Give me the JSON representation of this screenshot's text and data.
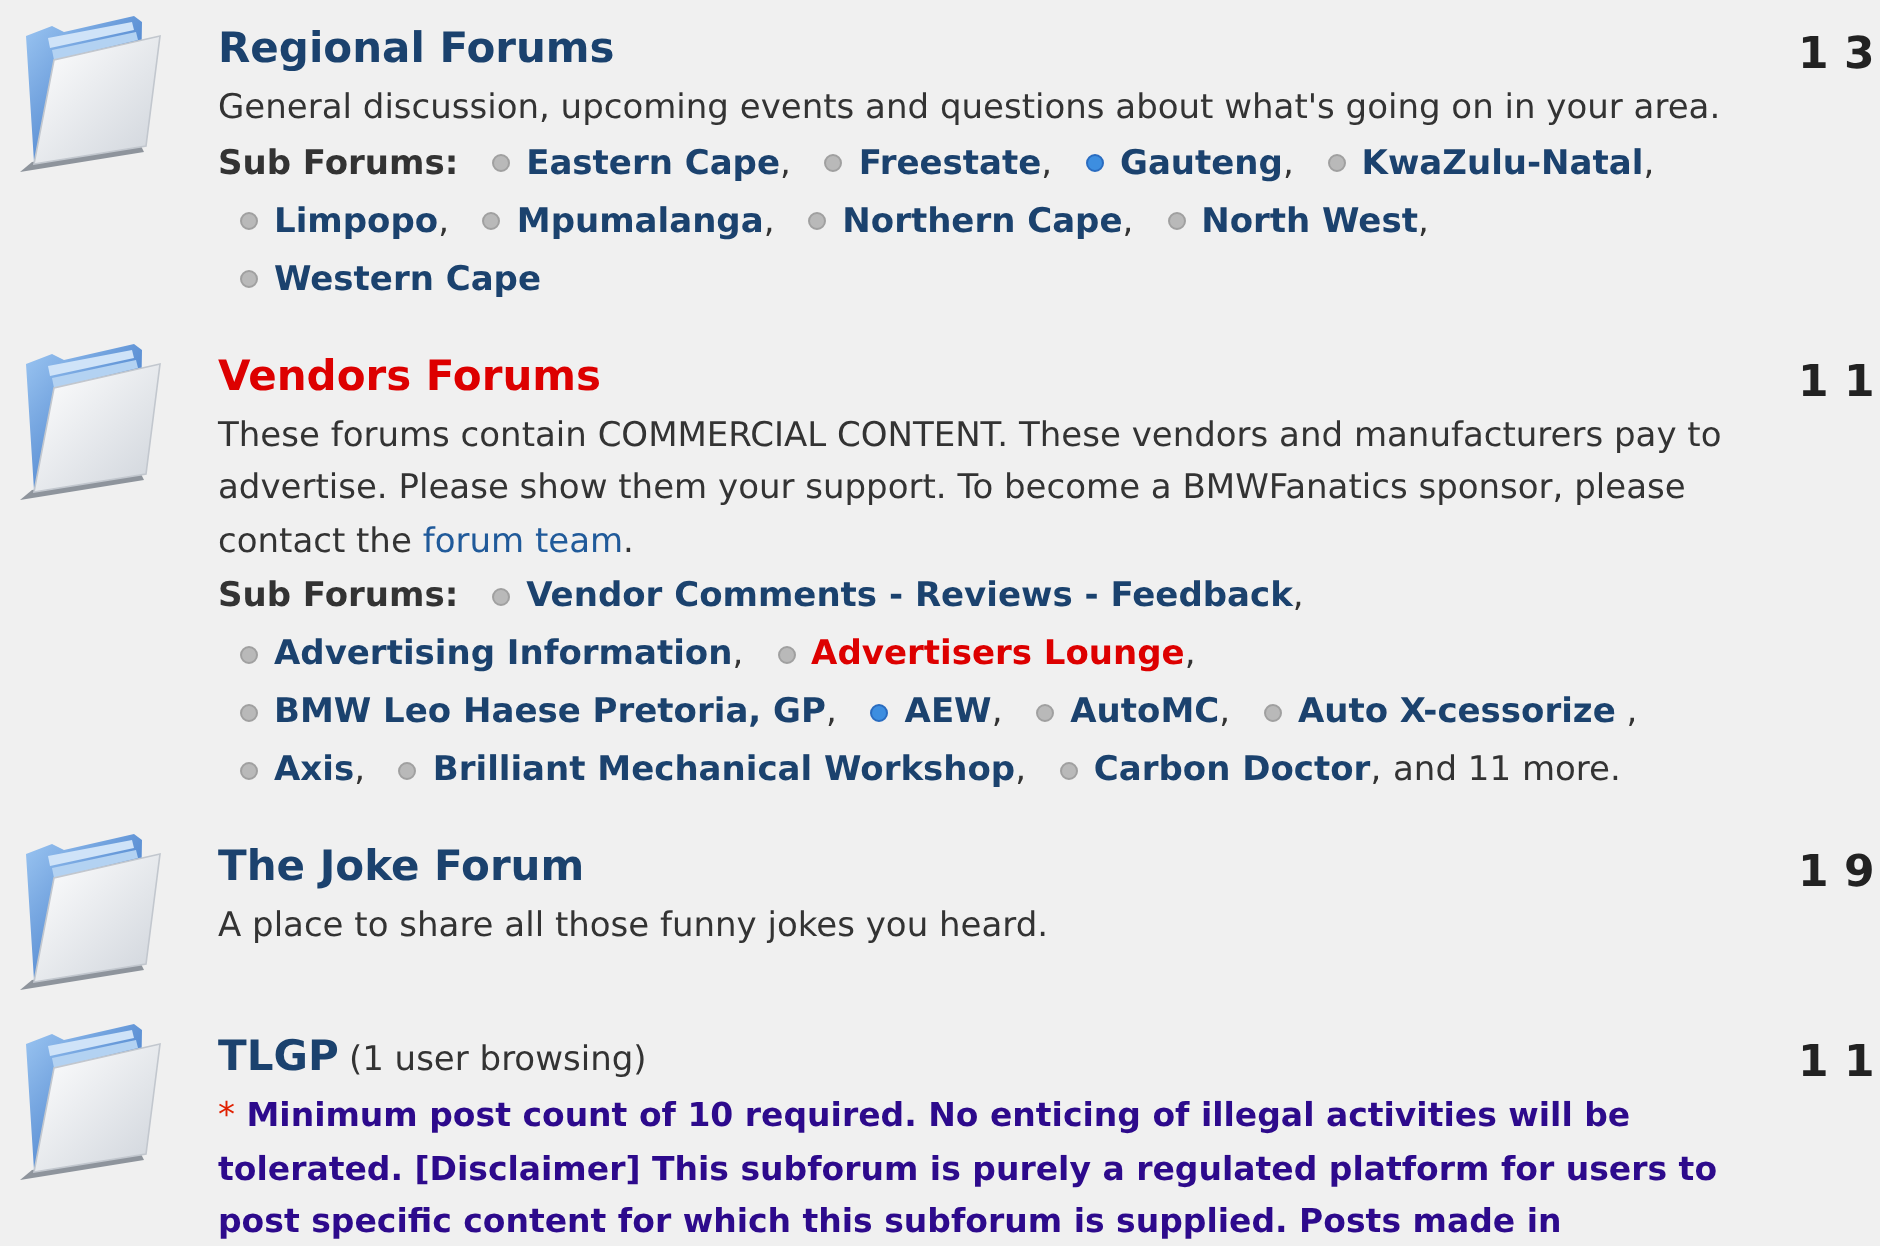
{
  "forums": [
    {
      "title": "Regional Forums",
      "color": "#1b426e",
      "description": [
        {
          "text": "General discussion, upcoming events and questions about what's going on in your area.",
          "kind": "text"
        }
      ],
      "subforums_label": "Sub Forums:",
      "subforums": [
        {
          "name": "Eastern Cape",
          "color": "#1b426e",
          "new_posts": false,
          "separator": ","
        },
        {
          "name": "Freestate",
          "color": "#1b426e",
          "new_posts": false,
          "separator": ","
        },
        {
          "name": "Gauteng",
          "color": "#1b426e",
          "new_posts": true,
          "separator": ","
        },
        {
          "name": "KwaZulu-Natal",
          "color": "#1b426e",
          "new_posts": false,
          "separator": ","
        },
        {
          "name": "Limpopo",
          "color": "#1b426e",
          "new_posts": false,
          "separator": ","
        },
        {
          "name": "Mpumalanga",
          "color": "#1b426e",
          "new_posts": false,
          "separator": ","
        },
        {
          "name": "Northern Cape",
          "color": "#1b426e",
          "new_posts": false,
          "separator": ","
        },
        {
          "name": "North West",
          "color": "#1b426e",
          "new_posts": false,
          "separator": ","
        },
        {
          "name": "Western Cape",
          "color": "#1b426e",
          "new_posts": false
        }
      ],
      "stats": "1 3"
    },
    {
      "title": "Vendors Forums",
      "color": "#dd0000",
      "description": [
        {
          "text": "These forums contain COMMERCIAL CONTENT. These vendors and manufacturers pay to advertise. Please show them your support. To become a BMWFanatics sponsor, please contact the ",
          "kind": "text"
        },
        {
          "text": "forum team",
          "kind": "link"
        },
        {
          "text": ".",
          "kind": "text"
        }
      ],
      "subforums_label": "Sub Forums:",
      "subforums": [
        {
          "name": "Vendor Comments - Reviews - Feedback",
          "color": "#1b426e",
          "new_posts": false,
          "separator": ","
        },
        {
          "name": "Advertising Information",
          "color": "#1b426e",
          "new_posts": false,
          "separator": ","
        },
        {
          "name": "Advertisers Lounge",
          "color": "#dd0000",
          "new_posts": false,
          "separator": ","
        },
        {
          "name": "BMW Leo Haese Pretoria, GP",
          "color": "#1b426e",
          "new_posts": false,
          "separator": ","
        },
        {
          "name": "AEW",
          "color": "#1b426e",
          "new_posts": true,
          "separator": ","
        },
        {
          "name": "AutoMC",
          "color": "#1b426e",
          "new_posts": false,
          "separator": ","
        },
        {
          "name": "Auto X-cessorize",
          "color": "#1b426e",
          "new_posts": false,
          "separator": " ,"
        },
        {
          "name": "Axis",
          "color": "#1b426e",
          "new_posts": false,
          "separator": ","
        },
        {
          "name": "Brilliant Mechanical Workshop",
          "color": "#1b426e",
          "new_posts": false,
          "separator": ","
        },
        {
          "name": "Carbon Doctor",
          "color": "#1b426e",
          "new_posts": false,
          "separator": ","
        }
      ],
      "more": "and 11 more.",
      "stats": "1 1"
    },
    {
      "title": "The Joke Forum",
      "color": "#1b426e",
      "description": [
        {
          "text": "A place to share all those funny jokes you heard.",
          "kind": "text"
        }
      ],
      "stats": "1 9"
    },
    {
      "title": "TLGP",
      "color": "#1b426e",
      "browsing": "(1 user browsing)",
      "description": [
        {
          "text": "*",
          "kind": "marker"
        },
        {
          "text": " Minimum post count of 10 required. No enticing of illegal activities will be tolerated. [Disclaimer] This subforum is purely a regulated platform for users to post specific content for which this subforum is supplied. Posts made in",
          "kind": "notice"
        }
      ],
      "stats": "1 1"
    }
  ]
}
